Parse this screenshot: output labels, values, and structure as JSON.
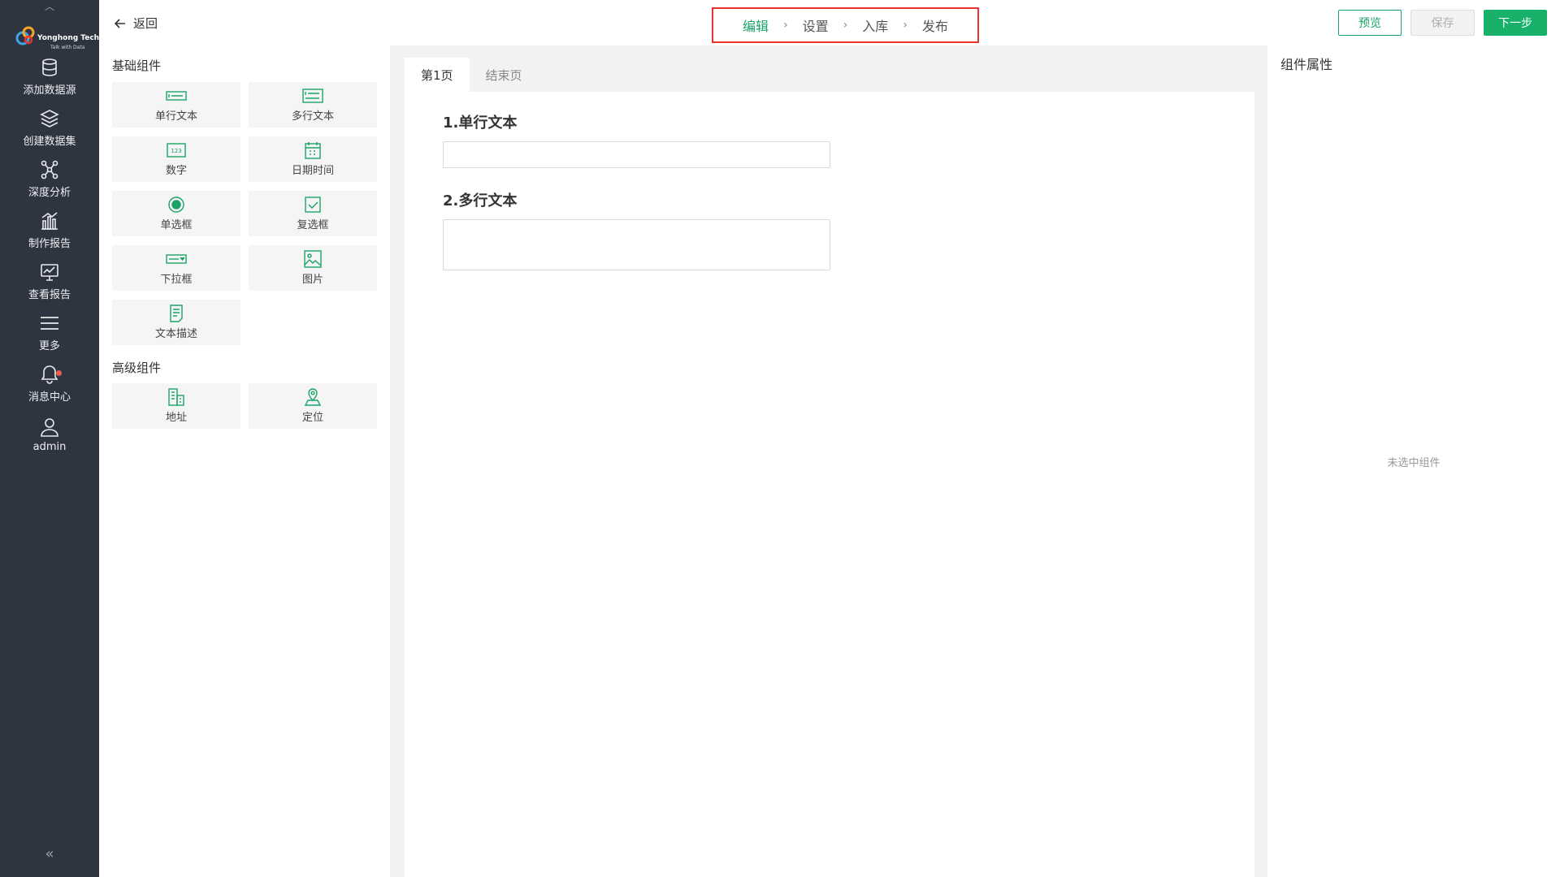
{
  "nav": {
    "logo_text": "Yonghong Tech",
    "logo_sub": "Talk with Data",
    "items": [
      {
        "label": "添加数据源",
        "icon": "database-icon"
      },
      {
        "label": "创建数据集",
        "icon": "layers-icon"
      },
      {
        "label": "深度分析",
        "icon": "network-icon"
      },
      {
        "label": "制作报告",
        "icon": "bar-chart-icon"
      },
      {
        "label": "查看报告",
        "icon": "monitor-chart-icon"
      },
      {
        "label": "更多",
        "icon": "menu-icon"
      },
      {
        "label": "消息中心",
        "icon": "bell-icon"
      },
      {
        "label": "admin",
        "icon": "user-icon"
      }
    ]
  },
  "topbar": {
    "back_label": "返回",
    "steps": [
      "编辑",
      "设置",
      "入库",
      "发布"
    ],
    "active_step": 0,
    "preview_label": "预览",
    "save_label": "保存",
    "next_label": "下一步"
  },
  "components": {
    "basic_title": "基础组件",
    "basic": [
      {
        "label": "单行文本",
        "icon": "single-line-text-icon"
      },
      {
        "label": "多行文本",
        "icon": "multi-line-text-icon"
      },
      {
        "label": "数字",
        "icon": "number-icon"
      },
      {
        "label": "日期时间",
        "icon": "calendar-icon"
      },
      {
        "label": "单选框",
        "icon": "radio-icon"
      },
      {
        "label": "复选框",
        "icon": "checkbox-icon"
      },
      {
        "label": "下拉框",
        "icon": "dropdown-icon"
      },
      {
        "label": "图片",
        "icon": "image-icon"
      },
      {
        "label": "文本描述",
        "icon": "text-description-icon"
      }
    ],
    "advanced_title": "高级组件",
    "advanced": [
      {
        "label": "地址",
        "icon": "address-icon"
      },
      {
        "label": "定位",
        "icon": "location-icon"
      }
    ],
    "number_icon_text": "123"
  },
  "canvas": {
    "tabs": [
      "第1页",
      "结束页"
    ],
    "active_tab": 0,
    "questions": [
      {
        "title": "1.单行文本",
        "type": "single"
      },
      {
        "title": "2.多行文本",
        "type": "multi"
      }
    ]
  },
  "props": {
    "title": "组件属性",
    "empty_text": "未选中组件"
  },
  "colors": {
    "accent": "#18b16a",
    "nav_bg": "#2f3441",
    "highlight_box": "#e8342f"
  }
}
